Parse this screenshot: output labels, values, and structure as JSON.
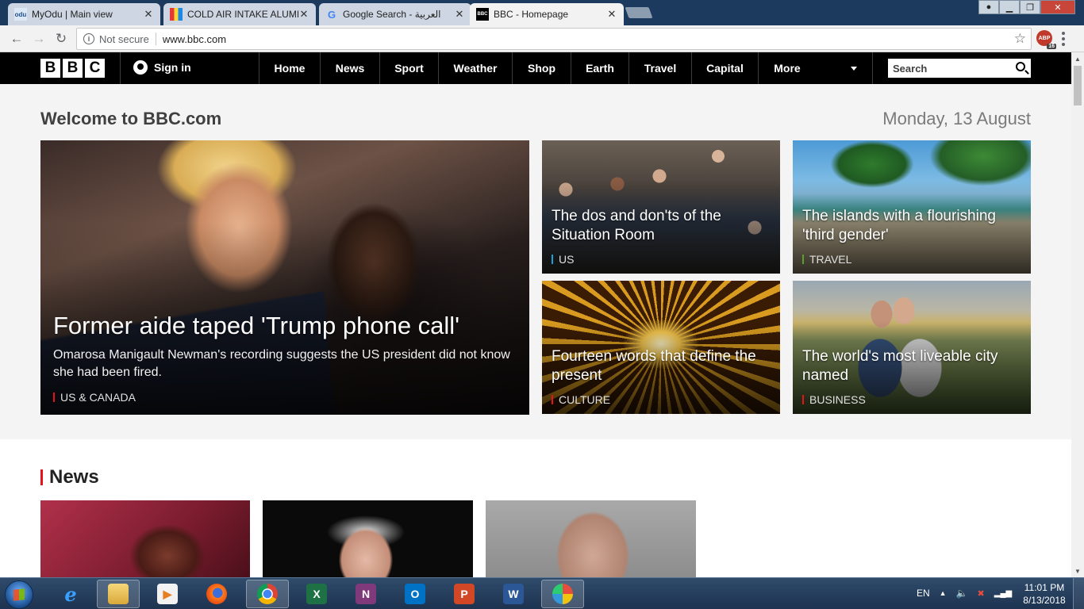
{
  "browser": {
    "tabs": [
      {
        "title": "MyOdu | Main view",
        "favicon": "odu",
        "active": false
      },
      {
        "title": "COLD AIR INTAKE ALUMI",
        "favicon": "multicolor",
        "active": false
      },
      {
        "title": "Google Search - العربية",
        "favicon": "G",
        "active": false
      },
      {
        "title": "BBC - Homepage",
        "favicon": "BBC",
        "active": true
      }
    ],
    "security": "Not secure",
    "url": "www.bbc.com",
    "extension_badge": "16",
    "extension_label": "ABP"
  },
  "bbc": {
    "logo": [
      "B",
      "B",
      "C"
    ],
    "signin": "Sign in",
    "nav": [
      "Home",
      "News",
      "Sport",
      "Weather",
      "Shop",
      "Earth",
      "Travel",
      "Capital",
      "More"
    ],
    "search_placeholder": "Search"
  },
  "page": {
    "welcome": "Welcome to BBC.com",
    "date": "Monday, 13 August",
    "main_story": {
      "headline": "Former aide taped 'Trump phone call'",
      "summary": "Omarosa Manigault Newman's recording suggests the US president did not know she had been fired.",
      "tag": "US & CANADA",
      "tag_color": "#e8121a"
    },
    "stories": [
      {
        "headline": "The dos and don'ts of the Situation Room",
        "tag": "US",
        "tag_color": "#1a9fd9"
      },
      {
        "headline": "The islands with a flourishing 'third gender'",
        "tag": "TRAVEL",
        "tag_color": "#5aa02c"
      },
      {
        "headline": "Fourteen words that define the present",
        "tag": "CULTURE",
        "tag_color": "#e8121a"
      },
      {
        "headline": "The world's most liveable city named",
        "tag": "BUSINESS",
        "tag_color": "#e8121a"
      }
    ],
    "news_section_title": "News"
  },
  "taskbar": {
    "language": "EN",
    "time": "11:01 PM",
    "date": "8/13/2018",
    "apps": [
      "internet-explorer",
      "file-explorer",
      "media-player",
      "firefox",
      "chrome",
      "excel",
      "onenote",
      "outlook",
      "powerpoint",
      "word",
      "paint"
    ]
  }
}
